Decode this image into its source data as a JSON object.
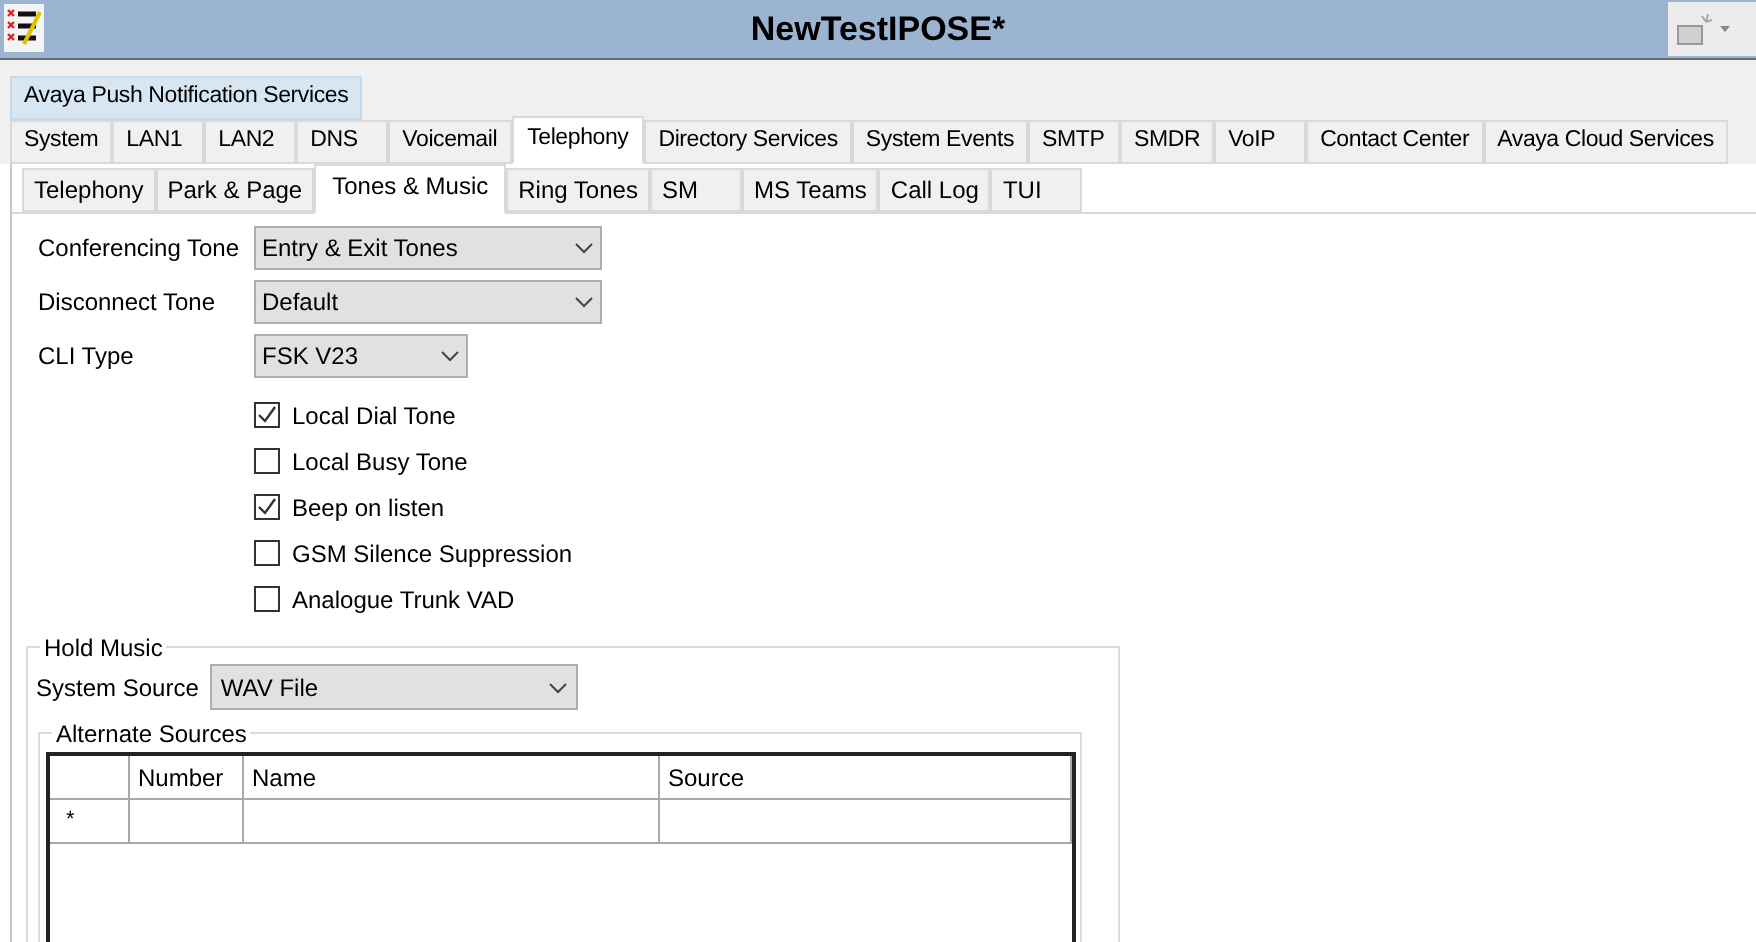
{
  "window": {
    "title": "NewTestIPOSE*"
  },
  "tab_rows": [
    [
      {
        "label": "Avaya Push Notification Services",
        "selected": false,
        "hovered": true
      }
    ],
    [
      {
        "label": "System",
        "selected": false,
        "hovered": false
      },
      {
        "label": "LAN1",
        "selected": false,
        "hovered": false
      },
      {
        "label": "LAN2",
        "selected": false,
        "hovered": false
      },
      {
        "label": "DNS",
        "selected": false,
        "hovered": false
      },
      {
        "label": "Voicemail",
        "selected": false,
        "hovered": false
      },
      {
        "label": "Telephony",
        "selected": true,
        "hovered": false
      },
      {
        "label": "Directory Services",
        "selected": false,
        "hovered": false
      },
      {
        "label": "System Events",
        "selected": false,
        "hovered": false
      },
      {
        "label": "SMTP",
        "selected": false,
        "hovered": false
      },
      {
        "label": "SMDR",
        "selected": false,
        "hovered": false
      },
      {
        "label": "VoIP",
        "selected": false,
        "hovered": false
      },
      {
        "label": "Contact Center",
        "selected": false,
        "hovered": false
      },
      {
        "label": "Avaya Cloud Services",
        "selected": false,
        "hovered": false
      }
    ]
  ],
  "sub_tabs": [
    {
      "label": "Telephony",
      "selected": false
    },
    {
      "label": "Park & Page",
      "selected": false
    },
    {
      "label": "Tones & Music",
      "selected": true
    },
    {
      "label": "Ring Tones",
      "selected": false
    },
    {
      "label": "SM",
      "selected": false
    },
    {
      "label": "MS Teams",
      "selected": false
    },
    {
      "label": "Call Log",
      "selected": false
    },
    {
      "label": "TUI",
      "selected": false
    }
  ],
  "fields": [
    {
      "label": "Conferencing Tone",
      "value": "Entry & Exit Tones",
      "kind": "wide"
    },
    {
      "label": "Disconnect Tone",
      "value": "Default",
      "kind": "wide"
    },
    {
      "label": "CLI Type",
      "value": "FSK V23",
      "kind": "narrow"
    }
  ],
  "checkboxes": [
    {
      "label": "Local Dial Tone",
      "checked": true
    },
    {
      "label": "Local Busy Tone",
      "checked": false
    },
    {
      "label": "Beep on listen",
      "checked": true
    },
    {
      "label": "GSM Silence Suppression",
      "checked": false
    },
    {
      "label": "Analogue Trunk VAD",
      "checked": false
    }
  ],
  "hold_music": {
    "title": "Hold Music",
    "system_source": {
      "label": "System Source",
      "value": "WAV File"
    },
    "alternate_sources": {
      "title": "Alternate Sources",
      "columns": [
        "Number",
        "Name",
        "Source"
      ],
      "new_row_marker": "*"
    }
  }
}
